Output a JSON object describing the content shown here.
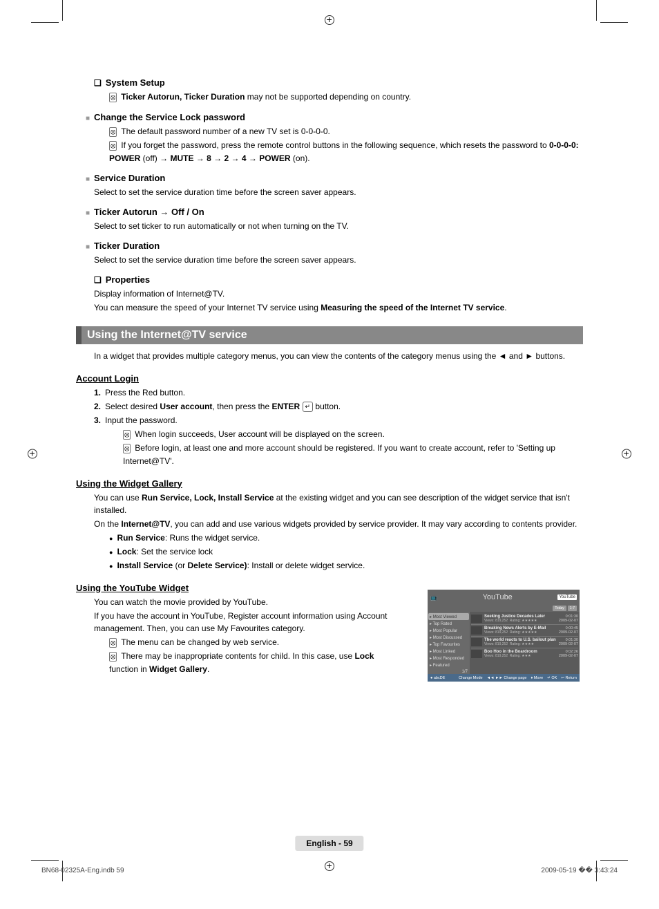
{
  "sections": {
    "system_setup": {
      "title": "System Setup",
      "note1_bold": "Ticker Autorun, Ticker Duration",
      "note1_rest": " may not be supported depending on country.",
      "change_password": {
        "title": "Change the Service Lock password",
        "note1": "The default password number of a new TV set is 0-0-0-0.",
        "note2_part1": "If you forget the password, press the remote control buttons in the following sequence, which resets the password to ",
        "note2_bold1": "0-0-0-0: POWER",
        "note2_part2": " (off) → ",
        "note2_bold2": "MUTE",
        "note2_part3": " → ",
        "note2_bold3": "8",
        "note2_part4": " → ",
        "note2_bold4": "2",
        "note2_part5": " → ",
        "note2_bold5": "4",
        "note2_part6": " → ",
        "note2_bold6": "POWER",
        "note2_part7": " (on)."
      },
      "service_duration": {
        "title": "Service Duration",
        "desc": "Select to set the service duration time before the screen saver appears."
      },
      "ticker_autorun": {
        "title": "Ticker Autorun → Off / On",
        "desc": "Select to set ticker to run automatically or not when turning on the TV."
      },
      "ticker_duration": {
        "title": "Ticker Duration",
        "desc": "Select to set the service duration time before the screen saver appears."
      }
    },
    "properties": {
      "title": "Properties",
      "line1": "Display information of Internet@TV.",
      "line2_part1": "You can measure the speed of your Internet TV service using ",
      "line2_bold": "Measuring the speed of the Internet TV service",
      "line2_part2": "."
    },
    "using_internet": {
      "title": "Using the Internet@TV service",
      "desc": "In a widget that provides multiple category menus, you can view the contents of the category menus using the ◄ and ► buttons."
    },
    "account_login": {
      "title": "Account Login",
      "step1": "Press the Red button.",
      "step2_part1": "Select desired ",
      "step2_bold1": "User account",
      "step2_part2": ", then press the ",
      "step2_bold2": "ENTER",
      "step2_part3": " button.",
      "step3": "Input the password.",
      "note1": "When login succeeds, User account will be displayed on the screen.",
      "note2": "Before login, at least one and more account should be registered. If you want to create account, refer to 'Setting up Internet@TV'."
    },
    "widget_gallery": {
      "title": "Using the Widget Gallery",
      "line1_part1": "You can use ",
      "line1_bold": "Run Service, Lock, Install Service",
      "line1_part2": " at the existing widget and you can see description of the widget service that isn't installed.",
      "line2_part1": "On the ",
      "line2_bold": "Internet@TV",
      "line2_part2": ", you can add and use various widgets provided by service provider. It may vary according to contents provider.",
      "bullet1_bold": "Run Service",
      "bullet1_rest": ": Runs the widget service.",
      "bullet2_bold": "Lock",
      "bullet2_rest": ": Set the service lock",
      "bullet3_bold1": "Install Service",
      "bullet3_mid": " (or ",
      "bullet3_bold2": "Delete Service)",
      "bullet3_rest": ": Install or delete widget service."
    },
    "youtube_widget": {
      "title": "Using the YouTube Widget",
      "line1": "You can watch the movie provided by YouTube.",
      "line2": "If you have the account in YouTube, Register account information using Account management. Then, you can use My Favourites category.",
      "note1": "The menu can be changed by web service.",
      "note2_part1": "There may be inappropriate contents for child. In this case, use ",
      "note2_bold1": "Lock",
      "note2_part2": " function in ",
      "note2_bold2": "Widget Gallery",
      "note2_part3": "."
    }
  },
  "youtube_ui": {
    "title": "YouTube",
    "logo": "YouTube",
    "tabs": [
      "Today",
      "1-7"
    ],
    "sidebar": [
      "Most Viewed",
      "Top Rated",
      "Most Popular",
      "Most Discussed",
      "Top Favourites",
      "Most Linked",
      "Most Responded",
      "Featured"
    ],
    "videos": [
      {
        "title": "Seeking Justice Decades Later",
        "views": "Views: 819,252",
        "rating": "Rating: ★★★★★",
        "time": "0:01:30",
        "date": "2009-02-07"
      },
      {
        "title": "Breaking News Alerts by E-Mail",
        "views": "Views: 819,252",
        "rating": "Rating: ★★★★★",
        "time": "0:00:45",
        "date": "2009-02-07"
      },
      {
        "title": "The world reacts to U.S. bailout plan",
        "views": "Views: 819,252",
        "rating": "Rating: ★★★★",
        "time": "0:01:30",
        "date": "2009-02-07"
      },
      {
        "title": "Boo Hoo in the Boardroom",
        "views": "Views: 819,252",
        "rating": "Rating: ★★★",
        "time": "0:02:26",
        "date": "2009-02-07"
      }
    ],
    "footer": {
      "left": "● abcDE",
      "mode": "Change Mode",
      "page": "◄◄ ►► Change page",
      "move": "♦ Move",
      "ok": "↵ OK",
      "return": "↩ Return"
    },
    "page_count": "1/7"
  },
  "page_footer": "English - 59",
  "print_left": "BN68-02325A-Eng.indb   59",
  "print_right": "2009-05-19   �� 3:43:24"
}
